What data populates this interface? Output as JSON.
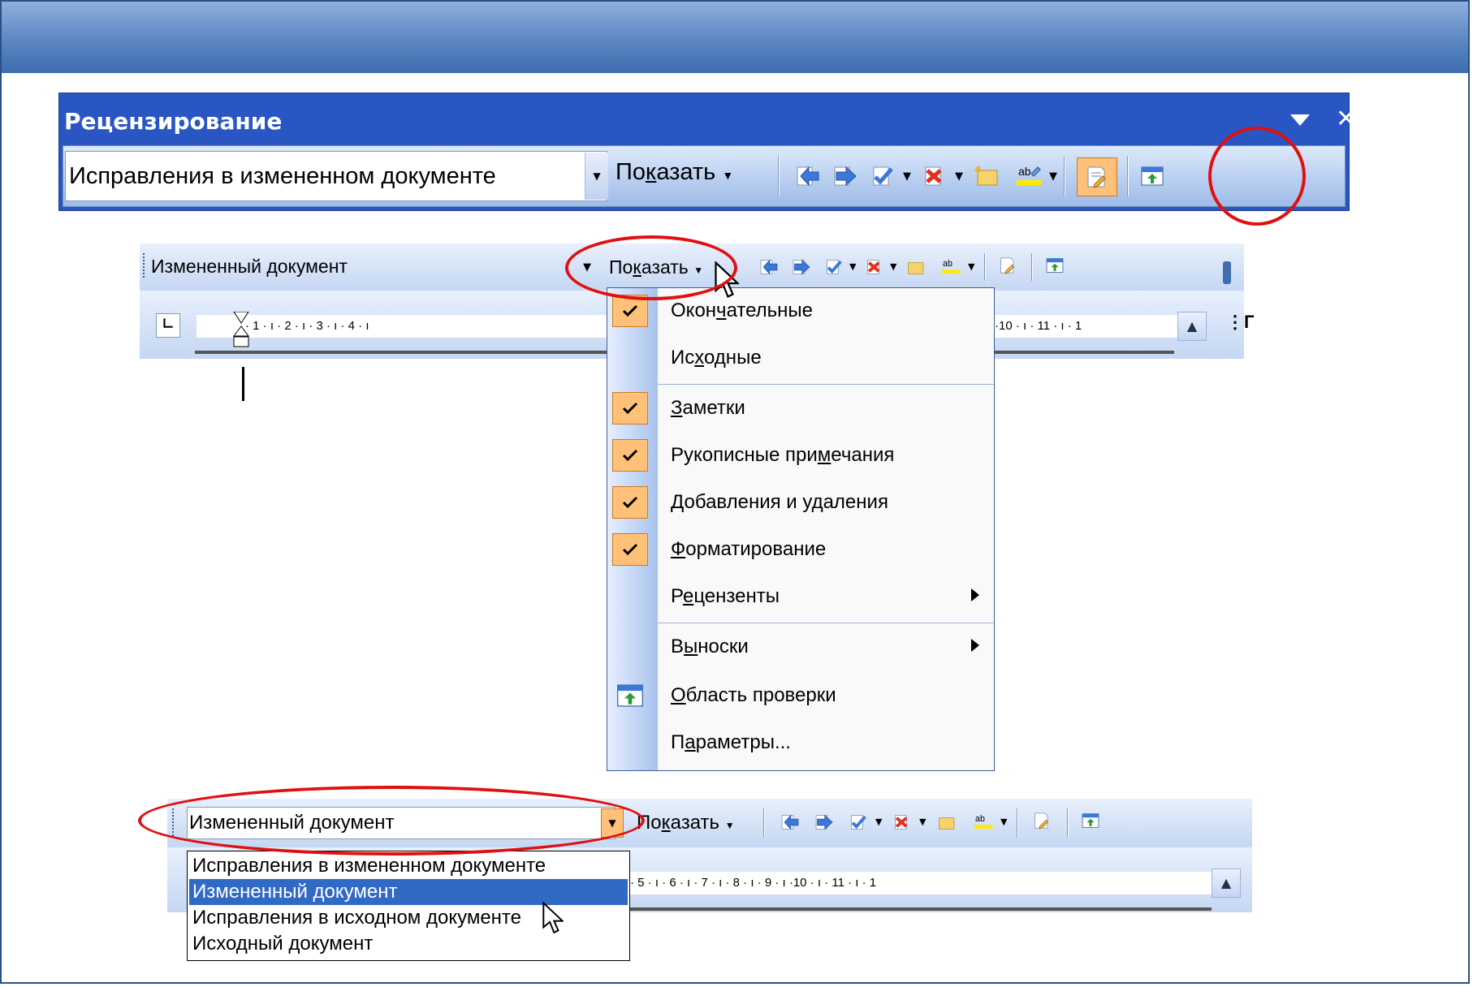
{
  "toolbar_main": {
    "title": "Рецензирование",
    "display_mode": "Исправления в измененном документе",
    "show_label_pre": "По",
    "show_label_key": "к",
    "show_label_post": "азать"
  },
  "toolbar_small": {
    "display_mode": "Измененный документ",
    "show_label_pre": "По",
    "show_label_key": "к",
    "show_label_post": "азать"
  },
  "ruler_top": "· 1 · ı · 2 · ı · 3 · ı · 4 · ı",
  "ruler_top_right": "·10 · ı · 11 · ı · 1",
  "ruler_bottom": "· 5 · ı · 6 · ı · 7 · ı · 8 · ı · 9 · ı ·10 · ı · 11 · ı · 1",
  "show_menu": {
    "items": [
      {
        "pre": "Окон",
        "key": "ч",
        "post": "ательные",
        "checked": true
      },
      {
        "pre": "Ис",
        "key": "х",
        "post": "одные",
        "checked": false
      },
      {
        "pre": "",
        "key": "З",
        "post": "аметки",
        "checked": true
      },
      {
        "pre": "Рукописные при",
        "key": "м",
        "post": "ечания",
        "checked": true
      },
      {
        "pre": "",
        "key": "Д",
        "post": "обавления и удаления",
        "checked": true
      },
      {
        "pre": "",
        "key": "Ф",
        "post": "орматирование",
        "checked": true
      },
      {
        "pre": "Р",
        "key": "е",
        "post": "цензенты",
        "checked": false
      },
      {
        "pre": "В",
        "key": "ы",
        "post": "носки",
        "checked": false
      },
      {
        "pre": "",
        "key": "О",
        "post": "бласть проверки",
        "checked": false
      },
      {
        "pre": "П",
        "key": "а",
        "post": "раметры...",
        "checked": false
      }
    ]
  },
  "display_dropdown": {
    "current": "Измененный документ",
    "options": [
      "Исправления в измененном документе",
      "Измененный документ",
      "Исправления в исходном документе",
      "Исходный документ"
    ],
    "selected_index": 1
  },
  "colors": {
    "title_bar": "#2a56c4",
    "highlight": "#ffc07a",
    "selection": "#316ac5",
    "annotation": "#e01010"
  }
}
